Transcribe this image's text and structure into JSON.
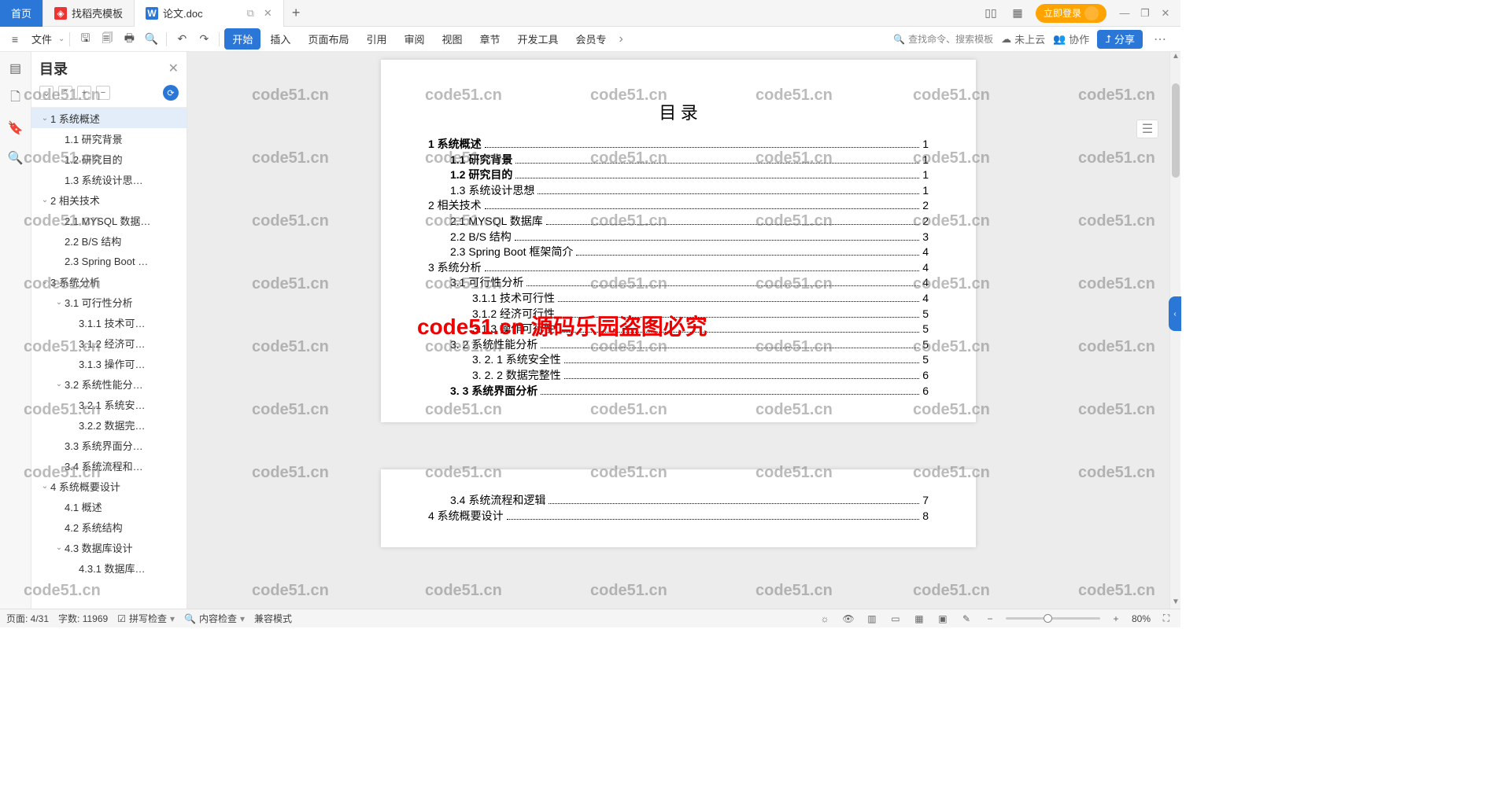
{
  "titlebar": {
    "home": "首页",
    "tab1_label": "找稻壳模板",
    "tab2_label": "论文.doc",
    "login": "立即登录"
  },
  "menubar": {
    "file": "文件",
    "items": [
      "开始",
      "插入",
      "页面布局",
      "引用",
      "审阅",
      "视图",
      "章节",
      "开发工具",
      "会员专"
    ],
    "search_placeholder": "查找命令、搜索模板",
    "cloud": "未上云",
    "coop": "协作",
    "share": "分享"
  },
  "toc_panel": {
    "title": "目录",
    "items": [
      {
        "level": 0,
        "expand": true,
        "text": "1 系统概述",
        "sel": true
      },
      {
        "level": 1,
        "expand": null,
        "text": "1.1 研究背景"
      },
      {
        "level": 1,
        "expand": null,
        "text": "1.2 研究目的"
      },
      {
        "level": 1,
        "expand": null,
        "text": "1.3 系统设计思…"
      },
      {
        "level": 0,
        "expand": true,
        "text": "2 相关技术"
      },
      {
        "level": 1,
        "expand": null,
        "text": "2.1 MYSQL 数据…"
      },
      {
        "level": 1,
        "expand": null,
        "text": "2.2 B/S 结构"
      },
      {
        "level": 1,
        "expand": null,
        "text": "2.3 Spring Boot …"
      },
      {
        "level": 0,
        "expand": true,
        "text": "3 系统分析"
      },
      {
        "level": 1,
        "expand": true,
        "text": "3.1 可行性分析"
      },
      {
        "level": 2,
        "expand": null,
        "text": "3.1.1 技术可…"
      },
      {
        "level": 2,
        "expand": null,
        "text": "3.1.2 经济可…"
      },
      {
        "level": 2,
        "expand": null,
        "text": "3.1.3 操作可…"
      },
      {
        "level": 1,
        "expand": true,
        "text": "3.2 系统性能分…"
      },
      {
        "level": 2,
        "expand": null,
        "text": "3.2.1 系统安…"
      },
      {
        "level": 2,
        "expand": null,
        "text": "3.2.2 数据完…"
      },
      {
        "level": 1,
        "expand": null,
        "text": "3.3 系统界面分…"
      },
      {
        "level": 1,
        "expand": null,
        "text": "3.4 系统流程和…"
      },
      {
        "level": 0,
        "expand": true,
        "text": "4 系统概要设计"
      },
      {
        "level": 1,
        "expand": null,
        "text": "4.1 概述"
      },
      {
        "level": 1,
        "expand": null,
        "text": "4.2 系统结构"
      },
      {
        "level": 1,
        "expand": true,
        "text": "4.3 数据库设计"
      },
      {
        "level": 2,
        "expand": null,
        "text": "4.3.1 数据库…"
      }
    ]
  },
  "document": {
    "title": "目 录",
    "toc": [
      {
        "text": "1 系统概述",
        "page": "1",
        "indent": 0,
        "bold": true
      },
      {
        "text": "1.1  研究背景",
        "page": "1",
        "indent": 1,
        "bold": true
      },
      {
        "text": "1.2 研究目的",
        "page": "1",
        "indent": 1,
        "bold": true
      },
      {
        "text": "1.3 系统设计思想",
        "page": "1",
        "indent": 1,
        "bold": false
      },
      {
        "text": "2 相关技术",
        "page": "2",
        "indent": 0,
        "bold": false
      },
      {
        "text": "2.1 MYSQL 数据库",
        "page": "2",
        "indent": 1,
        "bold": false
      },
      {
        "text": "2.2 B/S 结构",
        "page": "3",
        "indent": 1,
        "bold": false
      },
      {
        "text": "2.3 Spring Boot 框架简介",
        "page": "4",
        "indent": 1,
        "bold": false
      },
      {
        "text": "3 系统分析",
        "page": "4",
        "indent": 0,
        "bold": false
      },
      {
        "text": "3.1 可行性分析",
        "page": "4",
        "indent": 1,
        "bold": false
      },
      {
        "text": "3.1.1 技术可行性",
        "page": "4",
        "indent": 2,
        "bold": false
      },
      {
        "text": "3.1.2 经济可行性",
        "page": "5",
        "indent": 2,
        "bold": false
      },
      {
        "text": "3.1.3 操作可行性",
        "page": "5",
        "indent": 2,
        "bold": false
      },
      {
        "text": "3. 2 系统性能分析",
        "page": "5",
        "indent": 1,
        "bold": false
      },
      {
        "text": "3. 2. 1  系统安全性",
        "page": "5",
        "indent": 2,
        "bold": false
      },
      {
        "text": "3. 2. 2  数据完整性",
        "page": "6",
        "indent": 2,
        "bold": false
      },
      {
        "text": "3. 3 系统界面分析",
        "page": "6",
        "indent": 1,
        "bold": true
      }
    ],
    "toc2": [
      {
        "text": "3.4 系统流程和逻辑",
        "page": "7",
        "indent": 1,
        "bold": false
      },
      {
        "text": "4 系统概要设计",
        "page": "8",
        "indent": 0,
        "bold": false
      }
    ]
  },
  "statusbar": {
    "page": "页面: 4/31",
    "words": "字数: 11969",
    "spell": "拼写检查",
    "content": "内容检查",
    "compat": "兼容模式",
    "zoom": "80%"
  },
  "watermark": "code51.cn",
  "watermark_red": "code51.cn 源码乐园盗图必究"
}
